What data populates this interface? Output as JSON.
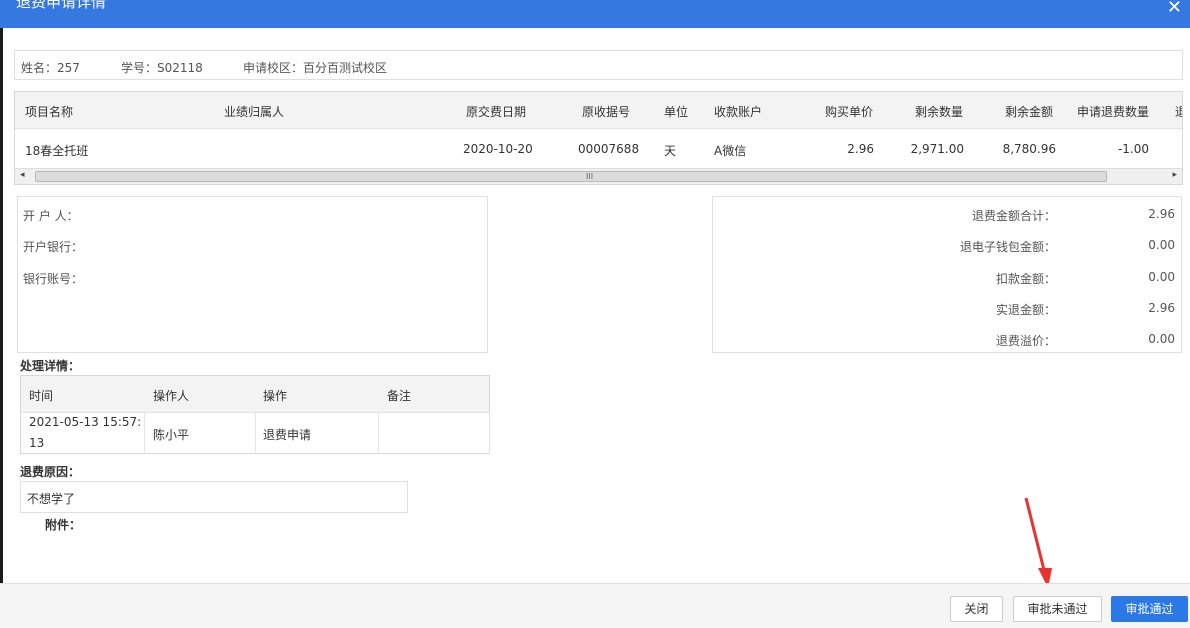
{
  "dialog": {
    "title": "退费申请详情",
    "close_glyph": "✕"
  },
  "student": {
    "name": "姓名：257",
    "id": "学号：S02118",
    "campus": "申请校区：百分百测试校区"
  },
  "table": {
    "headers": [
      "项目名称",
      "业绩归属人",
      "原交费日期",
      "原收据号",
      "单位",
      "收款账户",
      "购买单价",
      "剩余数量",
      "剩余金额",
      "申请退费数量",
      "退"
    ],
    "rows": [
      [
        "18春全托班",
        "",
        "2020-10-20",
        "00007688",
        "天",
        "A微信",
        "2.96",
        "2,971.00",
        "8,780.96",
        "-1.00",
        ""
      ]
    ],
    "scroll_left": "◂",
    "scroll_right": "▸",
    "scroll_grip": "III"
  },
  "bank": {
    "holder": "开 户 人：",
    "bank": "开户银行：",
    "account": "银行账号："
  },
  "summary": {
    "items": [
      {
        "label": "退费金额合计：",
        "value": "2.96"
      },
      {
        "label": "退电子钱包金额：",
        "value": "0.00"
      },
      {
        "label": "扣款金额：",
        "value": "0.00"
      },
      {
        "label": "实退金额：",
        "value": "2.96"
      },
      {
        "label": "退费溢价：",
        "value": "0.00"
      }
    ]
  },
  "processing": {
    "title": "处理详情：",
    "headers": [
      "时间",
      "操作人",
      "操作",
      "备注"
    ],
    "rows": [
      {
        "time_line1": "2021-05-13 15:57:",
        "time_line2": "13",
        "operator": "陈小平",
        "action": "退费申请",
        "note": ""
      }
    ]
  },
  "refund_reason": {
    "title": "退费原因：",
    "value": "不想学了"
  },
  "attachment": {
    "title": "附件："
  },
  "footer": {
    "close": "关闭",
    "reject": "审批未通过",
    "approve": "审批通过"
  },
  "colors": {
    "accent": "#2a79e6",
    "title_bar": "#3478e0",
    "annotation": "#e8322d"
  }
}
